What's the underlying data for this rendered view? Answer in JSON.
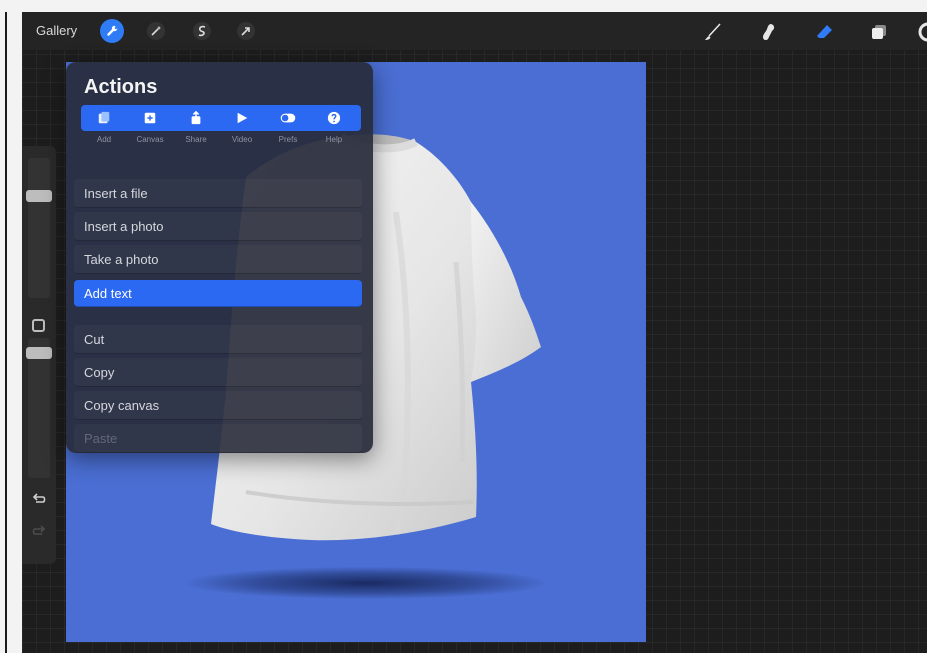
{
  "topbar": {
    "gallery_label": "Gallery",
    "left_tools": [
      "wrench-icon",
      "adjustments-wand-icon",
      "selection-s-icon",
      "transform-arrow-icon"
    ],
    "right_tools": [
      "brush-icon",
      "smudge-icon",
      "eraser-icon",
      "layers-icon",
      "color-circle-icon"
    ],
    "accent": "#2f7cf6"
  },
  "actions": {
    "title": "Actions",
    "tabs": [
      {
        "label": "Add",
        "icon": "add-file-icon"
      },
      {
        "label": "Canvas",
        "icon": "canvas-icon"
      },
      {
        "label": "Share",
        "icon": "share-icon"
      },
      {
        "label": "Video",
        "icon": "play-icon"
      },
      {
        "label": "Prefs",
        "icon": "toggle-icon"
      },
      {
        "label": "Help",
        "icon": "help-icon"
      }
    ],
    "selected_tab": "Add",
    "items": [
      {
        "label": "Insert a file"
      },
      {
        "label": "Insert a photo"
      },
      {
        "label": "Take a photo"
      },
      {
        "label": "Add text"
      },
      {
        "label": "Cut"
      },
      {
        "label": "Copy"
      },
      {
        "label": "Copy canvas"
      },
      {
        "label": "Paste"
      }
    ],
    "selected_item": "Add text",
    "disabled_item": "Paste"
  },
  "canvas": {
    "background_color": "#4a6ed3",
    "subject": "white-tshirt-mockup"
  },
  "sidebar": {
    "icons": [
      "modify-square-icon",
      "undo-icon",
      "redo-icon"
    ]
  }
}
